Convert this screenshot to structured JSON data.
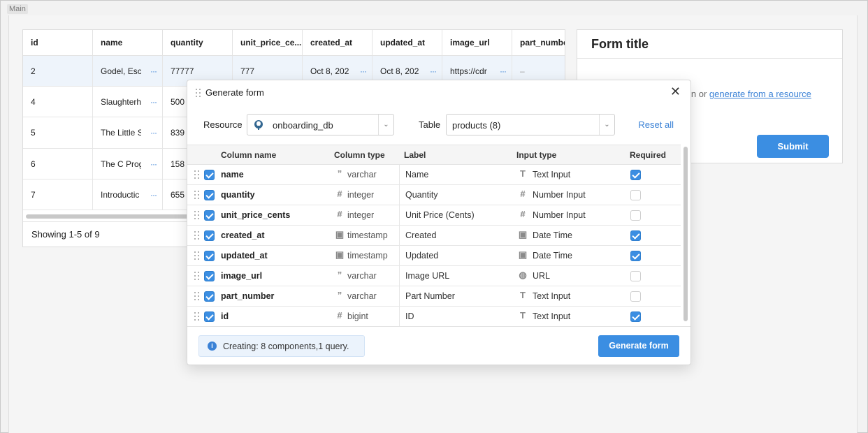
{
  "main_tag": "Main",
  "table": {
    "columns": [
      "id",
      "name",
      "quantity",
      "unit_price_ce...",
      "created_at",
      "updated_at",
      "image_url",
      "part_numbe"
    ],
    "rows": [
      {
        "id": "2",
        "name": "Godel, Esc",
        "quantity": "77777",
        "unit_price": "777",
        "created_at": "Oct 8, 202",
        "updated_at": "Oct 8, 202",
        "image_url": "https://cdr",
        "part_number": "–"
      },
      {
        "id": "4",
        "name": "Slaughterh",
        "quantity": "500"
      },
      {
        "id": "5",
        "name": "The Little S",
        "quantity": "839"
      },
      {
        "id": "6",
        "name": "The C Prog",
        "quantity": "158"
      },
      {
        "id": "7",
        "name": "Introductic",
        "quantity": "655"
      }
    ],
    "more_glyph": "···",
    "footer": "Showing 1-5 of 9"
  },
  "form": {
    "title": "Form title",
    "hint_prefix": "in or",
    "hint_link": "generate from a resource",
    "submit_label": "Submit"
  },
  "modal": {
    "title": "Generate form",
    "close_glyph": "✕",
    "resource_label": "Resource",
    "resource_value": "onboarding_db",
    "table_label": "Table",
    "table_value": "products (8)",
    "reset_label": "Reset all",
    "headers": {
      "column_name": "Column name",
      "column_type": "Column type",
      "label": "Label",
      "input_type": "Input type",
      "required": "Required"
    },
    "rows": [
      {
        "name": "name",
        "type": "varchar",
        "type_icon": "quote-icon",
        "label": "Name",
        "input": "Text Input",
        "input_icon": "text-icon",
        "required": true
      },
      {
        "name": "quantity",
        "type": "integer",
        "type_icon": "hash-icon",
        "label": "Quantity",
        "input": "Number Input",
        "input_icon": "hash-icon",
        "required": false
      },
      {
        "name": "unit_price_cents",
        "type": "integer",
        "type_icon": "hash-icon",
        "label": "Unit Price (Cents)",
        "input": "Number Input",
        "input_icon": "hash-icon",
        "required": false
      },
      {
        "name": "created_at",
        "type": "timestamp",
        "type_icon": "calendar-clock-icon",
        "label": "Created",
        "input": "Date Time",
        "input_icon": "calendar-clock-icon",
        "required": true
      },
      {
        "name": "updated_at",
        "type": "timestamp",
        "type_icon": "calendar-clock-icon",
        "label": "Updated",
        "input": "Date Time",
        "input_icon": "calendar-clock-icon",
        "required": true
      },
      {
        "name": "image_url",
        "type": "varchar",
        "type_icon": "quote-icon",
        "label": "Image URL",
        "input": "URL",
        "input_icon": "globe-icon",
        "required": false
      },
      {
        "name": "part_number",
        "type": "varchar",
        "type_icon": "quote-icon",
        "label": "Part Number",
        "input": "Text Input",
        "input_icon": "text-icon",
        "required": false
      },
      {
        "name": "id",
        "type": "bigint",
        "type_icon": "hash-icon",
        "label": "ID",
        "input": "Text Input",
        "input_icon": "text-icon",
        "required": true
      }
    ],
    "info_text": "Creating: 8 components,1 query.",
    "generate_label": "Generate form"
  },
  "colors": {
    "accent": "#3b8ee2",
    "link": "#3b82d6",
    "selected_row": "#eef4fb"
  }
}
